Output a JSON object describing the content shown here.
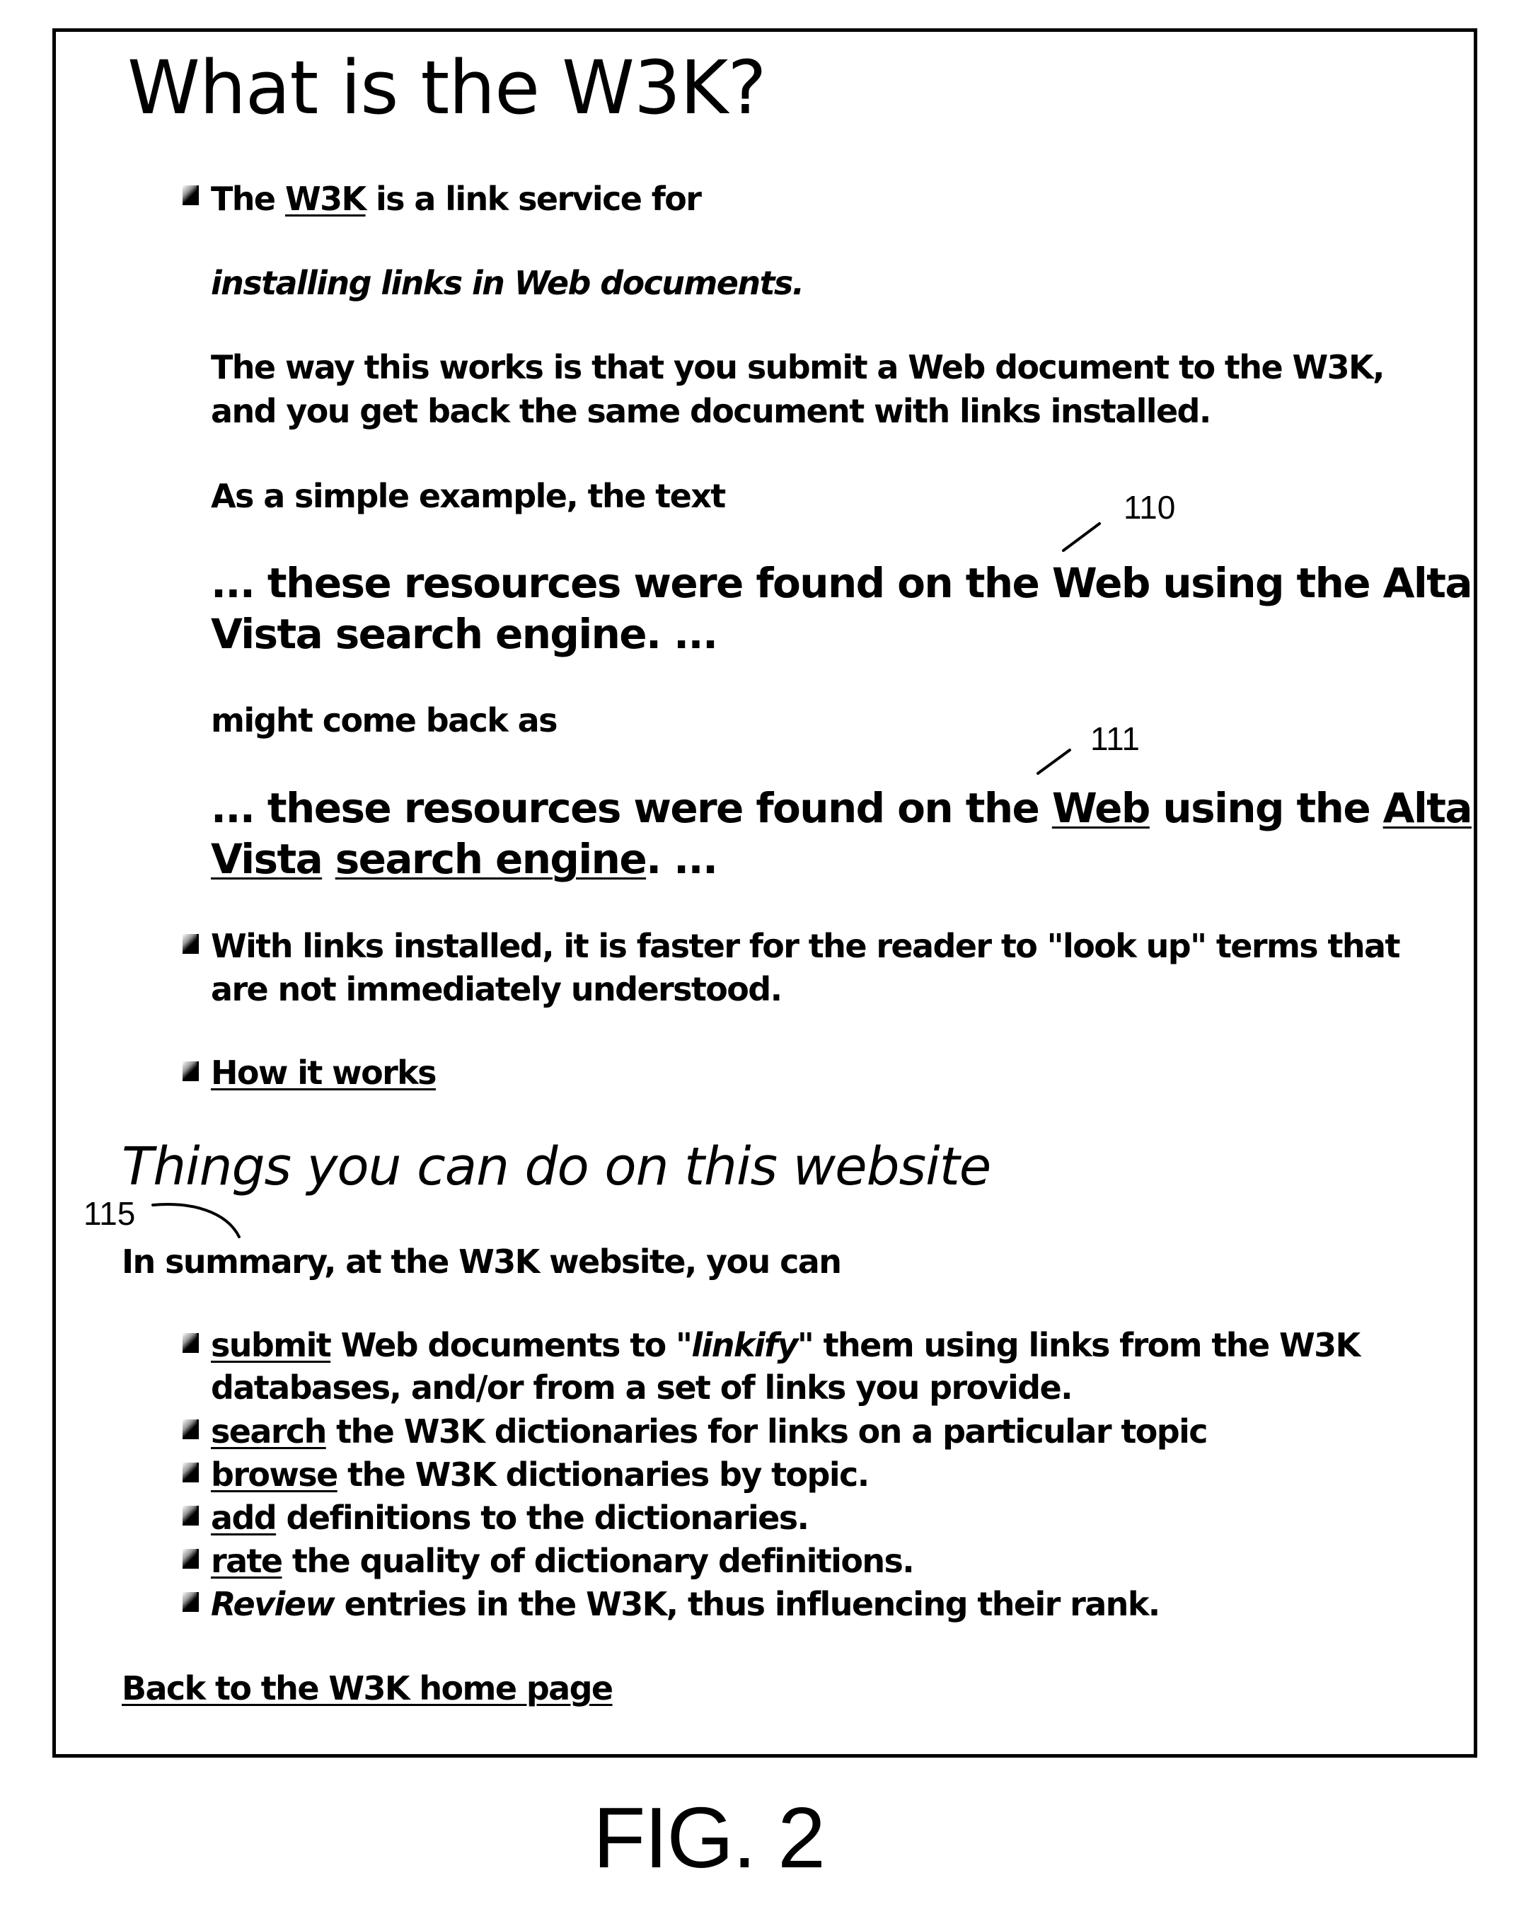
{
  "section1": {
    "title": "What is the W3K?",
    "intro": {
      "prefix": "The ",
      "w3k_link": "W3K",
      "middle": " is a ",
      "bold": "link service",
      "suffix": " for"
    },
    "tagline": "installing links in Web documents.",
    "paragraph_lines": [
      "The way this works is that you submit a Web document to the W3K,",
      "and you get back the same document with links installed."
    ],
    "example_intro": "As a simple example, the text",
    "example_plain_lines": [
      "... these resources were found on the Web using the Alta",
      "Vista search engine. ..."
    ],
    "example_mid": "might come back as",
    "example_linked": {
      "l1_a": "... these resources were found on the ",
      "l1_link1": "Web",
      "l1_b": " using the ",
      "l1_link2": "Alta",
      "l2_link1": "Vista",
      "l2_sp": " ",
      "l2_link2": "search engine",
      "l2_end": ". ..."
    },
    "bullet2_lines": [
      "With links installed, it is faster for the reader to \"look up\" terms that",
      "are not immediately understood."
    ],
    "how_it_works_link": "How it works"
  },
  "section2": {
    "heading": "Things you can do on this website",
    "summary": "In summary, at the W3K website, you can",
    "items": [
      {
        "link": "submit",
        "rest_a": " Web documents to ",
        "italic": "\"linkify\"",
        "rest_b": " them using links from the W3K",
        "line2": "databases, and/or from a set of links you provide."
      },
      {
        "link": "search",
        "rest": " the W3K dictionaries for links on a particular topic"
      },
      {
        "link": "browse",
        "rest": " the W3K dictionaries by topic."
      },
      {
        "link": "add",
        "rest": " definitions to the dictionaries."
      },
      {
        "link": "rate",
        "rest": " the quality of dictionary definitions."
      },
      {
        "italic": "Review",
        "rest": " entries in the W3K, thus influencing their rank."
      }
    ],
    "back_link": "Back to the W3K home page"
  },
  "annotations": {
    "ref_110": "110",
    "ref_111": "111",
    "ref_115": "115"
  },
  "figure_label": "FIG. 2"
}
